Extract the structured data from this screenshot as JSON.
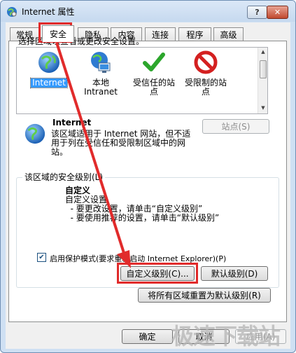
{
  "window": {
    "title": "Internet 属性",
    "help_label": "?",
    "close_label": "✕"
  },
  "tabs": [
    {
      "label": "常规",
      "active": false
    },
    {
      "label": "安全",
      "active": true
    },
    {
      "label": "隐私",
      "active": false
    },
    {
      "label": "内容",
      "active": false
    },
    {
      "label": "连接",
      "active": false
    },
    {
      "label": "程序",
      "active": false
    },
    {
      "label": "高级",
      "active": false
    }
  ],
  "security": {
    "zone_prompt": "选择区域以查看或更改安全设置。",
    "zones": [
      {
        "name": "Internet",
        "icon": "globe-icon",
        "selected": true
      },
      {
        "name": "本地\nIntranet",
        "icon": "local-intranet-icon",
        "selected": false
      },
      {
        "name": "受信任的站\n点",
        "icon": "check-icon",
        "selected": false
      },
      {
        "name": "受限制的站\n点",
        "icon": "restricted-icon",
        "selected": false
      }
    ],
    "selected_zone_title": "Internet",
    "selected_zone_desc": "该区域适用于 Internet 网站，但不适用于列在受信任和受限制区域中的网站。",
    "sites_button": "站点(S)",
    "level_group_title": "该区域的安全级别(L)",
    "custom_title": "自定义",
    "custom_desc": "自定义设置\n  - 要更改设置，请单击“自定义级别”\n  - 要使用推荐的设置，请单击“默认级别”",
    "protected_mode_label": "启用保护模式(要求重新启动 Internet Explorer)(P)",
    "protected_mode_checked": true,
    "custom_level_button": "自定义级别(C)...",
    "default_level_button": "默认级别(D)",
    "reset_all_button": "将所有区域重置为默认级别(R)"
  },
  "footer": {
    "ok_button": "确定",
    "cancel_button": "取消",
    "apply_button": "应用(A)"
  },
  "watermark": "极速下载站",
  "annotation_color": "#e12b2b"
}
